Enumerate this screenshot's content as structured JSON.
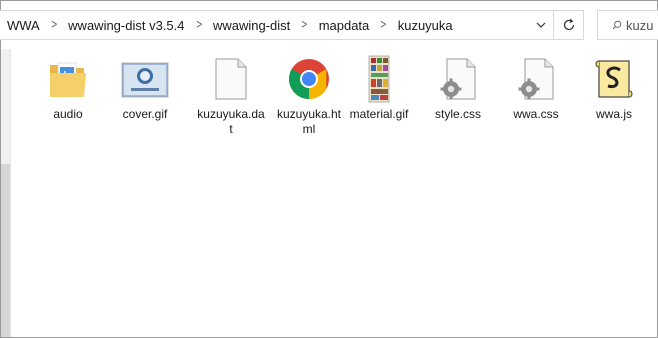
{
  "breadcrumb": {
    "items": [
      "WWA",
      "wwawing-dist v3.5.4",
      "wwawing-dist",
      "mapdata",
      "kuzuyuka"
    ]
  },
  "search": {
    "value": "kuzu"
  },
  "files": [
    {
      "name": "audio",
      "icon": "folder-icon"
    },
    {
      "name": "cover.gif",
      "icon": "gif-image-icon"
    },
    {
      "name": "kuzuyuka.dat",
      "icon": "blank-file-icon"
    },
    {
      "name": "kuzuyuka.html",
      "icon": "chrome-icon"
    },
    {
      "name": "material.gif",
      "icon": "gif-image-icon"
    },
    {
      "name": "style.css",
      "icon": "css-file-icon"
    },
    {
      "name": "wwa.css",
      "icon": "css-file-icon"
    },
    {
      "name": "wwa.js",
      "icon": "js-script-icon"
    }
  ],
  "colors": {
    "accent": "#0078d7",
    "border": "#d9d9d9"
  }
}
